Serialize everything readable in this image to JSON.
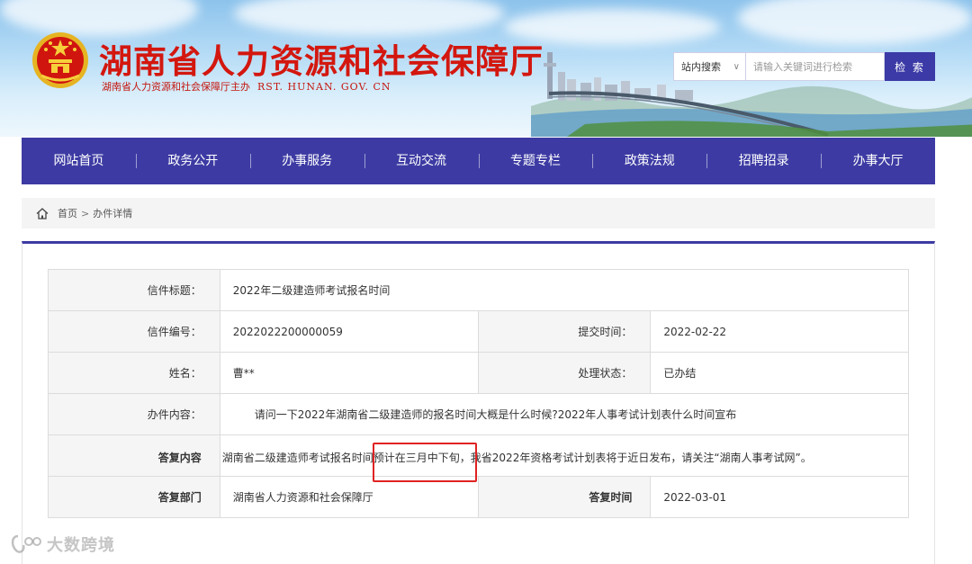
{
  "header": {
    "title": "湖南省人力资源和社会保障厅",
    "subtitle": "湖南省人力资源和社会保障厅主办",
    "domain": "RST. HUNAN. GOV. CN"
  },
  "search": {
    "scope": "站内搜索",
    "placeholder": "请输入关键词进行检索",
    "button": "检 索"
  },
  "nav": {
    "items": [
      "网站首页",
      "政务公开",
      "办事服务",
      "互动交流",
      "专题专栏",
      "政策法规",
      "招聘招录",
      "办事大厅"
    ]
  },
  "breadcrumb": {
    "home": "首页",
    "sep": ">",
    "current": "办件详情"
  },
  "detail": {
    "title_label": "信件标题：",
    "title_value": "2022年二级建造师考试报名时间",
    "number_label": "信件编号：",
    "number_value": "2022022200000059",
    "submit_label": "提交时间：",
    "submit_value": "2022-02-22",
    "name_label": "姓名：",
    "name_value": "曹**",
    "status_label": "处理状态：",
    "status_value": "已办结",
    "content_label": "办件内容：",
    "content_value": "请问一下2022年湖南省二级建造师的报名时间大概是什么时候?2022年人事考试计划表什么时间宣布",
    "reply_label": "答复内容",
    "reply_value": "湖南省二级建造师考试报名时间预计在三月中下旬，我省2022年资格考试计划表将于近日发布，请关注“湖南人事考试网”。",
    "dept_label": "答复部门",
    "dept_value": "湖南省人力资源和社会保障厅",
    "reply_time_label": "答复时间",
    "reply_time_value": "2022-03-01"
  },
  "watermark": {
    "text": "大数跨境"
  },
  "colors": {
    "brand_red": "#d3170f",
    "nav_blue": "#3d3ba3",
    "highlight_red": "#e02222"
  }
}
